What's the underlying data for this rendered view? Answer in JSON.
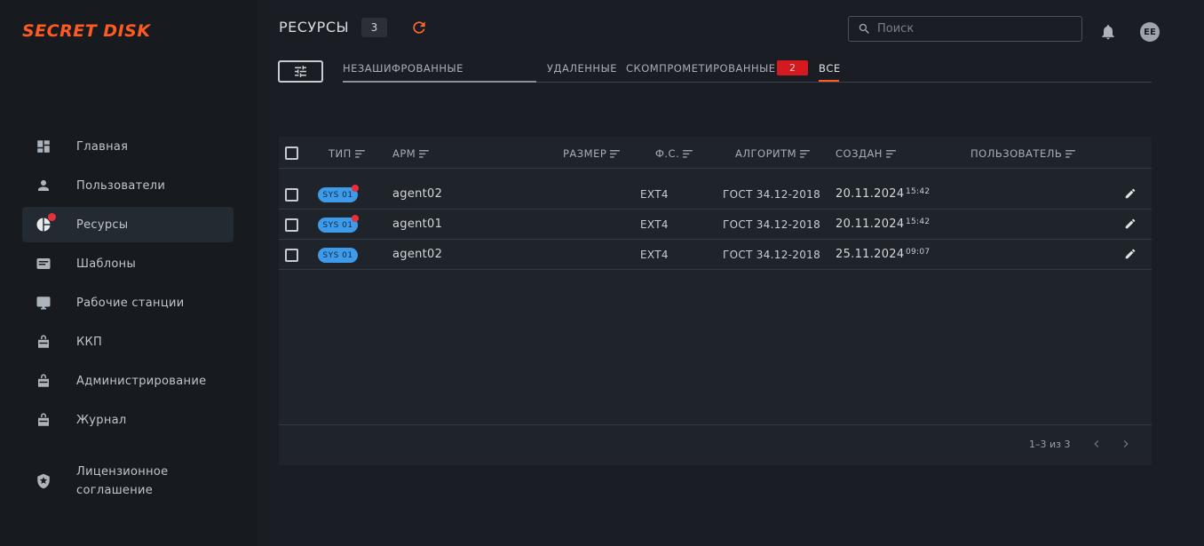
{
  "app": {
    "logo": "SECRET DISK"
  },
  "sidebar": {
    "items": [
      {
        "label": "Главная",
        "icon": "dashboard-icon"
      },
      {
        "label": "Пользователи",
        "icon": "person-icon"
      },
      {
        "label": "Ресурсы",
        "icon": "pie-chart-icon",
        "active": true,
        "has_notification": true
      },
      {
        "label": "Шаблоны",
        "icon": "template-icon"
      },
      {
        "label": "Рабочие станции",
        "icon": "monitor-icon"
      },
      {
        "label": "ККП",
        "icon": "lock-box-icon"
      },
      {
        "label": "Администрирование",
        "icon": "lock-box-icon"
      },
      {
        "label": "Журнал",
        "icon": "lock-box-icon"
      },
      {
        "label": "Лицензионное соглашение",
        "icon": "shield-star-icon"
      }
    ]
  },
  "header": {
    "title": "РЕСУРСЫ",
    "count": "3",
    "search_placeholder": "Поиск",
    "avatar_initials": "EE"
  },
  "tabs": [
    {
      "label": "НЕЗАШИФРОВАННЫЕ"
    },
    {
      "label": "УДАЛЕННЫЕ"
    },
    {
      "label": "СКОМПРОМЕТИРОВАННЫЕ",
      "badge": "2"
    },
    {
      "label": "ВСЕ",
      "active": true
    }
  ],
  "table": {
    "columns": [
      "ТИП",
      "АРМ",
      "РАЗМЕР",
      "Ф.С.",
      "АЛГОРИТМ",
      "СОЗДАН",
      "ПОЛЬЗОВАТЕЛЬ"
    ],
    "rows": [
      {
        "type": "SYS 01",
        "alert": true,
        "arm": "agent02",
        "size": "",
        "fs": "EXT4",
        "algorithm": "ГОСТ 34.12-2018",
        "date": "20.11.2024",
        "time": "15:42",
        "user": ""
      },
      {
        "type": "SYS 01",
        "alert": true,
        "arm": "agent01",
        "size": "",
        "fs": "EXT4",
        "algorithm": "ГОСТ 34.12-2018",
        "date": "20.11.2024",
        "time": "15:42",
        "user": ""
      },
      {
        "type": "SYS 01",
        "alert": false,
        "arm": "agent02",
        "size": "",
        "fs": "EXT4",
        "algorithm": "ГОСТ 34.12-2018",
        "date": "25.11.2024",
        "time": "09:07",
        "user": ""
      }
    ]
  },
  "pagination": {
    "label": "1–3 из 3"
  },
  "colors": {
    "accent": "#ff5a1f",
    "badge_blue": "#3d9be9",
    "alert_red": "#e8303a"
  }
}
